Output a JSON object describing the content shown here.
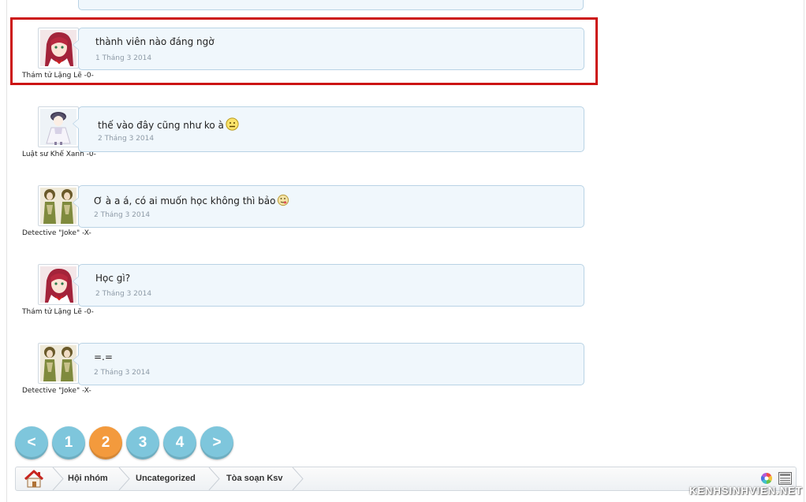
{
  "messages": [
    {
      "text": "thành viên nào đáng ngờ",
      "date": "1 Tháng 3 2014",
      "author": "Thám tử Lặng Lẽ -0-",
      "avatar": "red-hair-girl-avatar",
      "highlighted": true
    },
    {
      "text": "thế vào đây cũng như ko à",
      "date": "2 Tháng 3 2014",
      "author": "Luật sư Khế Xanh -0-",
      "avatar": "white-dress-girl-avatar",
      "emoji": "frown-smiley-icon"
    },
    {
      "text": "Ơ à a á, có ai muốn học không thì bảo",
      "date": "2 Tháng 3 2014",
      "author": "Detective \"Joke\" -X-",
      "avatar": "twin-figures-avatar",
      "emoji": "tongue-smiley-icon"
    },
    {
      "text": "Học gì?",
      "date": "2 Tháng 3 2014",
      "author": "Thám tử Lặng Lẽ -0-",
      "avatar": "red-hair-girl-avatar"
    },
    {
      "text": "=.=",
      "date": "2 Tháng 3 2014",
      "author": "Detective \"Joke\" -X-",
      "avatar": "twin-figures-avatar"
    }
  ],
  "pagination": {
    "prev": "<",
    "pages": [
      "1",
      "2",
      "3",
      "4"
    ],
    "current": "2",
    "next": ">"
  },
  "breadcrumb": {
    "home_icon": "home-icon",
    "items": [
      "Hội nhóm",
      "Uncategorized",
      "Tòa soạn Ksv"
    ],
    "right_icons": [
      "color-wheel-icon",
      "list-view-icon"
    ]
  },
  "watermark": "KENHSINHVIEN.NET",
  "colors": {
    "highlight": "#cc1414",
    "page_button": "#7ec6dc",
    "page_active": "#f39a3d",
    "bubble_bg": "#f0f7fc",
    "bubble_border": "#b9d3e5"
  }
}
